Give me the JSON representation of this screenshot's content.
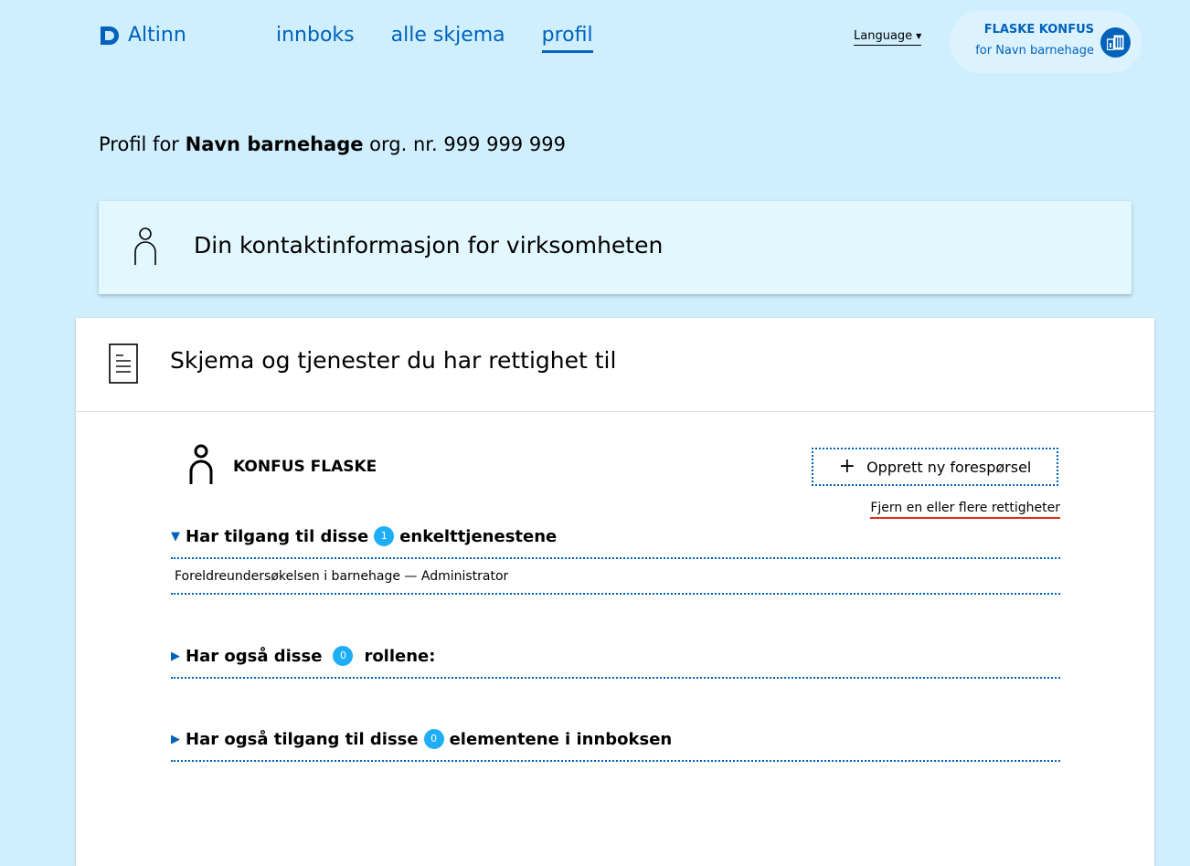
{
  "header": {
    "logo_text": "Altinn",
    "nav": [
      {
        "label": "innboks",
        "active": false
      },
      {
        "label": "alle skjema",
        "active": false
      },
      {
        "label": "profil",
        "active": true
      }
    ],
    "language_label": "Language",
    "user_name": "FLASKE KONFUS",
    "user_org": "for Navn barnehage",
    "accent_color": "#0062ba"
  },
  "page": {
    "title_prefix": "Profil for",
    "title_org": "Navn barnehage",
    "title_suffix": "org. nr. 999 999 999"
  },
  "contact": {
    "title": "Din kontaktinformasjon for virksomheten"
  },
  "rights": {
    "title": "Skjema og tjenester du har rettighet til",
    "person_name": "KONFUS FLASKE",
    "new_request_label": "Opprett ny forespørsel",
    "remove_label": "Fjern en eller flere rettigheter",
    "sections": [
      {
        "prefix": "Har tilgang til disse",
        "count": "1",
        "suffix": "enkelttjenestene",
        "expanded": true
      },
      {
        "prefix": "Har også disse",
        "count": "0",
        "suffix": "rollene:",
        "expanded": false
      },
      {
        "prefix": "Har også tilgang til disse",
        "count": "0",
        "suffix": "elementene i innboksen",
        "expanded": false
      }
    ],
    "service_item": "Foreldreundersøkelsen i barnehage — Administrator"
  }
}
